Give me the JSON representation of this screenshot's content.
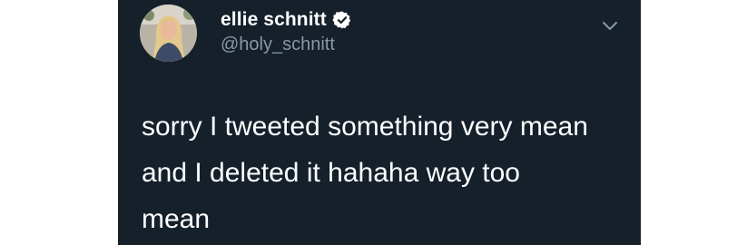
{
  "tweet": {
    "display_name": "ellie schnitt",
    "handle": "@holy_schnitt",
    "text": "sorry I tweeted something very mean\nand I deleted it hahaha way too\nmean",
    "verified": true
  },
  "icons": {
    "verified": "verified-badge-icon",
    "menu": "chevron-down-icon"
  },
  "colors": {
    "card_background": "#15202b",
    "name_text": "#ffffff",
    "handle_text": "#8899a6",
    "tweet_text": "#ffffff"
  }
}
